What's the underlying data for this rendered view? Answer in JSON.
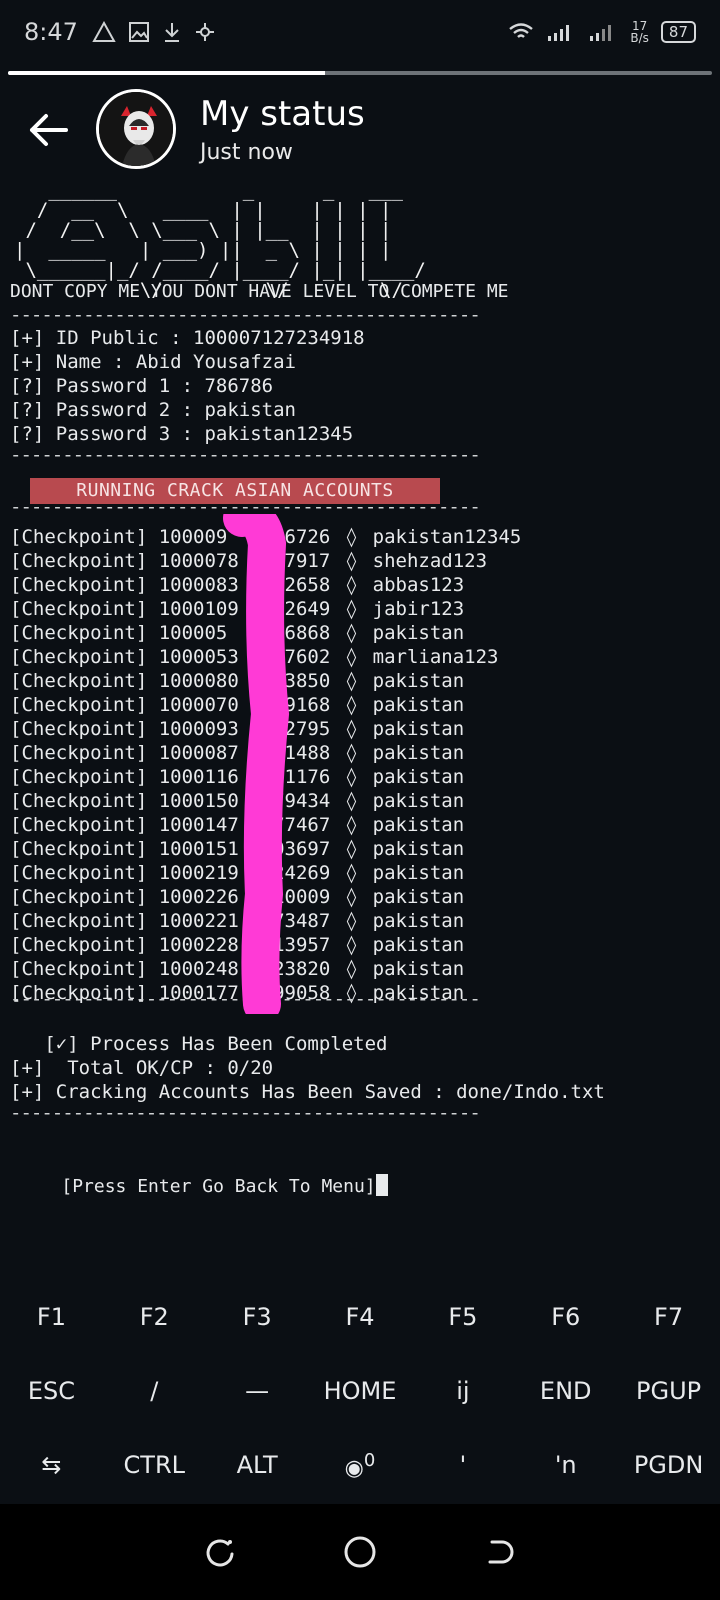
{
  "status_bar": {
    "time": "8:47",
    "net_speed_top": "17",
    "net_speed_bottom": "B/s",
    "battery": "87",
    "icons": [
      "warning-triangle-icon",
      "gallery-icon",
      "download-icon",
      "app-icon",
      "wifi-icon",
      "signal-icon",
      "signal-icon-2"
    ]
  },
  "story": {
    "progress": 0.45,
    "title": "My status",
    "subtitle": "Just now"
  },
  "terminal": {
    "ascii_logo": "   ______           _      _   ___\n  /  __  \\   ____  | |    | | | |\n /  /__\\  \\ \\___ \\ | |__  | | | |\n|  _____   | ___) ||  _ \\ | | | |\n \\______|_/ /____/ |____/ |_| |____/\n           \\/         \\/        \\/",
    "tagline": "DONT COPY ME YOU DONT HAVE LEVEL TO COMPETE ME",
    "divider": "---------------------------------------------",
    "info": [
      "[+] ID Public : 100007127234918",
      "[+] Name : Abid Yousafzai",
      "[?] Password 1 : 786786",
      "[?] Password 2 : pakistan",
      "[?] Password 3 : pakistan12345"
    ],
    "banner": "RUNNING CRACK ASIAN ACCOUNTS",
    "checkpoint_tag": "[Checkpoint]",
    "separator": "◊",
    "results": [
      {
        "id": "100009  7596726",
        "pw": "pakistan12345"
      },
      {
        "id": "1000078  237917",
        "pw": "shehzad123"
      },
      {
        "id": "1000083  502658",
        "pw": "abbas123"
      },
      {
        "id": "1000109  822649",
        "pw": "jabir123"
      },
      {
        "id": "100005   136868",
        "pw": "pakistan"
      },
      {
        "id": "1000053  007602",
        "pw": "marliana123"
      },
      {
        "id": "1000080  773850",
        "pw": "pakistan"
      },
      {
        "id": "1000070  219168",
        "pw": "pakistan"
      },
      {
        "id": "1000093  572795",
        "pw": "pakistan"
      },
      {
        "id": "1000087  921488",
        "pw": "pakistan"
      },
      {
        "id": "1000116  661176",
        "pw": "pakistan"
      },
      {
        "id": "1000150  979434",
        "pw": "pakistan"
      },
      {
        "id": "1000147  577467",
        "pw": "pakistan"
      },
      {
        "id": "1000151  203697",
        "pw": "pakistan"
      },
      {
        "id": "1000219  924269",
        "pw": "pakistan"
      },
      {
        "id": "1000226  410009",
        "pw": "pakistan"
      },
      {
        "id": "1000221  773487",
        "pw": "pakistan"
      },
      {
        "id": "1000228  213957",
        "pw": "pakistan"
      },
      {
        "id": "1000248  623820",
        "pw": "pakistan"
      },
      {
        "id": "1000177  499058",
        "pw": "pakistan"
      }
    ],
    "completed": "   [✓] Process Has Been Completed",
    "total": "[+]  Total OK/CP : 0/20",
    "saved": "[+] Cracking Accounts Has Been Saved : done/Indo.txt",
    "prompt": "[Press Enter Go Back To Menu]",
    "scribble_color": "#ff3ad6"
  },
  "extra_keys": {
    "row1": [
      "F1",
      "F2",
      "F3",
      "F4",
      "F5",
      "F6",
      "F7"
    ],
    "row2": [
      "ESC",
      "/",
      "—",
      "HOME",
      "ij",
      "END",
      "PGUP"
    ],
    "row3": [
      "⇆",
      "CTRL",
      "ALT",
      "0",
      "'",
      "'n",
      "PGDN"
    ]
  },
  "colors": {
    "background": "#0b0f14",
    "banner": "#b84a4f",
    "text": "#e8eaec"
  }
}
